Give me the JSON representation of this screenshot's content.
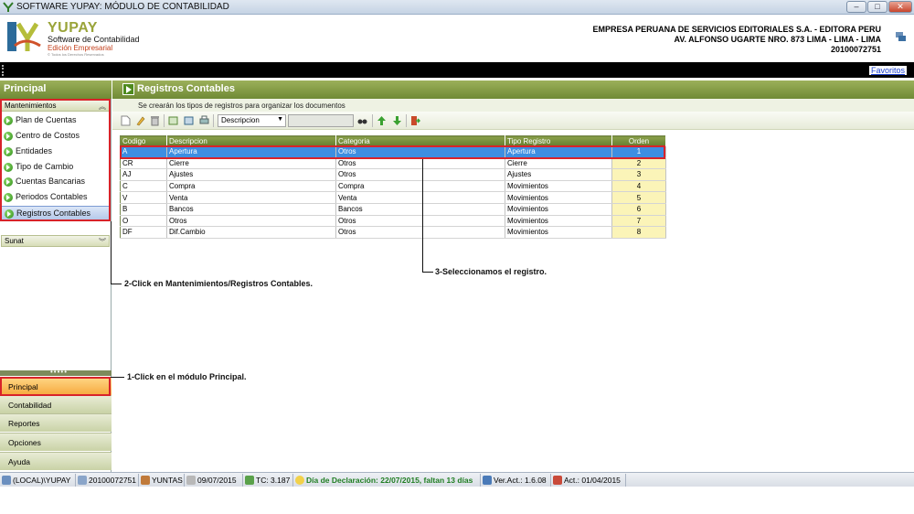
{
  "window": {
    "title": "SOFTWARE YUPAY: MÓDULO DE CONTABILIDAD",
    "minimize": "–",
    "maximize": "□",
    "close": "✕"
  },
  "logo": {
    "name": "YUPAY",
    "subtitle": "Software de Contabilidad",
    "edition": "Edición Empresarial",
    "rights": "© Todos los Derechos Reservados"
  },
  "company": {
    "name": "EMPRESA PERUANA DE SERVICIOS EDITORIALES S.A. - EDITORA PERU",
    "address": "AV. ALFONSO UGARTE NRO. 873 LIMA - LIMA - LIMA",
    "ruc": "20100072751"
  },
  "favorites": "Favoritos",
  "sidebar": {
    "header": "Principal",
    "group_mantenimientos": "Mantenimientos",
    "items": [
      {
        "label": "Plan de Cuentas"
      },
      {
        "label": "Centro de Costos"
      },
      {
        "label": "Entidades"
      },
      {
        "label": "Tipo de Cambio"
      },
      {
        "label": "Cuentas Bancarias"
      },
      {
        "label": "Periodos Contables"
      },
      {
        "label": "Registros Contables"
      }
    ],
    "group_sunat": "Sunat",
    "splitter": "•••••",
    "modules": [
      "Principal",
      "Contabilidad",
      "Reportes",
      "Opciones",
      "Ayuda"
    ]
  },
  "main": {
    "title": "Registros Contables",
    "subtitle": "Se crearán los tipos de registros para organizar los documentos",
    "filter": {
      "selected": "Descripcion",
      "value": ""
    }
  },
  "grid": {
    "columns": [
      "Codigo",
      "Descripcion",
      "Categoria",
      "Tipo Registro",
      "Orden"
    ],
    "rows": [
      [
        "A",
        "Apertura",
        "Otros",
        "Apertura",
        "1"
      ],
      [
        "CR",
        "Cierre",
        "Otros",
        "Cierre",
        "2"
      ],
      [
        "AJ",
        "Ajustes",
        "Otros",
        "Ajustes",
        "3"
      ],
      [
        "C",
        "Compra",
        "Compra",
        "Movimientos",
        "4"
      ],
      [
        "V",
        "Venta",
        "Venta",
        "Movimientos",
        "5"
      ],
      [
        "B",
        "Bancos",
        "Bancos",
        "Movimientos",
        "6"
      ],
      [
        "O",
        "Otros",
        "Otros",
        "Movimientos",
        "7"
      ],
      [
        "DF",
        "Dif.Cambio",
        "Otros",
        "Movimientos",
        "8"
      ]
    ]
  },
  "annotations": {
    "step1": "1-Click en el módulo Principal.",
    "step2": "2-Click en Mantenimientos/Registros Contables.",
    "step3": "3-Seleccionamos el registro."
  },
  "status": {
    "server": "(LOCAL)\\YUPAY",
    "ruc": "20100072751",
    "user": "YUNTAS",
    "date": "09/07/2015",
    "tc": "TC: 3.187",
    "declaration": "Día de Declaración: 22/07/2015, faltan 13 días",
    "version": "Ver.Act.: 1.6.08",
    "update": "Act.: 01/04/2015"
  }
}
